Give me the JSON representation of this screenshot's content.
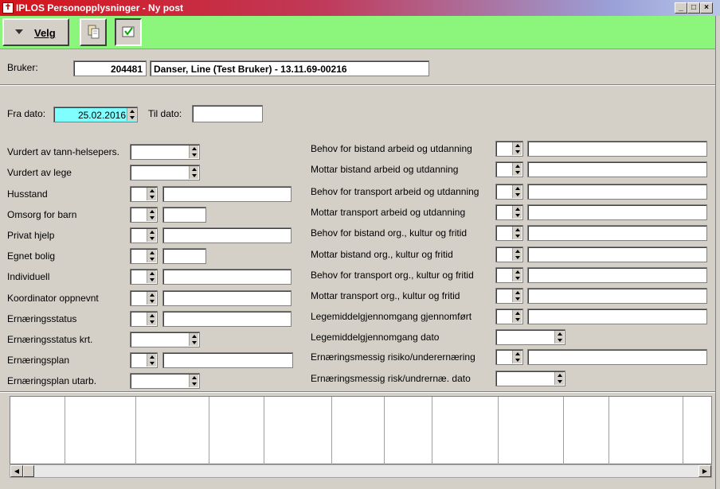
{
  "window": {
    "title": "IPLOS Personopplysninger - Ny post",
    "minimize": "_",
    "maximize": "□",
    "close": "×"
  },
  "toolbar": {
    "velg_label": "Velg"
  },
  "bruker": {
    "label": "Bruker:",
    "id": "204481",
    "name": "Danser, Line (Test Bruker) - 13.11.69-00216"
  },
  "dates": {
    "fra_label": "Fra dato:",
    "fra_value": "25.02.2016",
    "til_label": "Til dato:",
    "til_value": ""
  },
  "left_fields": [
    {
      "label": "Vurdert av tann-helsepers."
    },
    {
      "label": "Vurdert av lege"
    },
    {
      "label": "Husstand"
    },
    {
      "label": "Omsorg for barn"
    },
    {
      "label": "Privat hjelp"
    },
    {
      "label": "Egnet bolig"
    },
    {
      "label": "Individuell"
    },
    {
      "label": "Koordinator oppnevnt"
    },
    {
      "label": "Ernæringsstatus"
    },
    {
      "label": "Ernæringsstatus krt."
    },
    {
      "label": "Ernæringsplan"
    },
    {
      "label": "Ernæringsplan utarb."
    }
  ],
  "right_fields": [
    {
      "label": "Behov for bistand arbeid og utdanning"
    },
    {
      "label": "Mottar bistand arbeid og utdanning"
    },
    {
      "label": "Behov for transport arbeid og utdanning"
    },
    {
      "label": "Mottar transport arbeid og utdanning"
    },
    {
      "label": "Behov for bistand org., kultur og fritid"
    },
    {
      "label": "Mottar bistand org., kultur og fritid"
    },
    {
      "label": "Behov for transport org., kultur og fritid"
    },
    {
      "label": "Mottar transport org., kultur og fritid"
    },
    {
      "label": "Legemiddelgjennomgang gjennomført"
    },
    {
      "label": "Legemiddelgjennomgang dato"
    },
    {
      "label": "Ernæringsmessig risiko/underernæring"
    },
    {
      "label": "Ernæringsmessig risk/undrernæ. dato"
    }
  ],
  "scroll": {
    "left": "◀",
    "right": "▶"
  },
  "colors": {
    "toolbar": "#8cf57c",
    "date_highlight": "#7fffff",
    "background": "#d4d0c8"
  }
}
